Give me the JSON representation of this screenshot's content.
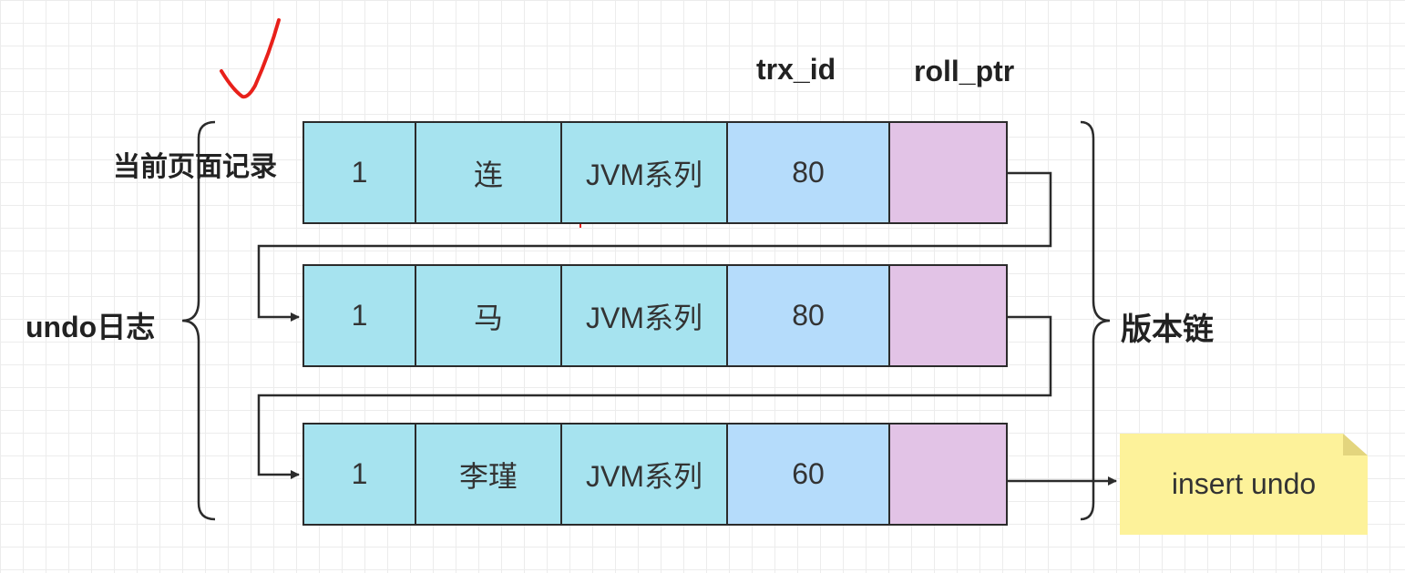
{
  "headers": {
    "trx_id": "trx_id",
    "roll_ptr": "roll_ptr"
  },
  "labels": {
    "current_record": "当前页面记录",
    "undo_log": "undo日志",
    "version_chain": "版本链"
  },
  "rows": [
    {
      "id": "1",
      "name": "连",
      "course": "JVM系列",
      "trx_id": "80",
      "roll_ptr": ""
    },
    {
      "id": "1",
      "name": "马",
      "course": "JVM系列",
      "trx_id": "80",
      "roll_ptr": ""
    },
    {
      "id": "1",
      "name": "李瑾",
      "course": "JVM系列",
      "trx_id": "60",
      "roll_ptr": ""
    }
  ],
  "note": {
    "text": "insert undo"
  },
  "colors": {
    "cell": "#a6e3ef",
    "trx_id_cell": "#b5dcfb",
    "roll_ptr_cell": "#e2c3e6",
    "note": "#fdf29a",
    "annotation": "#e8201a"
  }
}
